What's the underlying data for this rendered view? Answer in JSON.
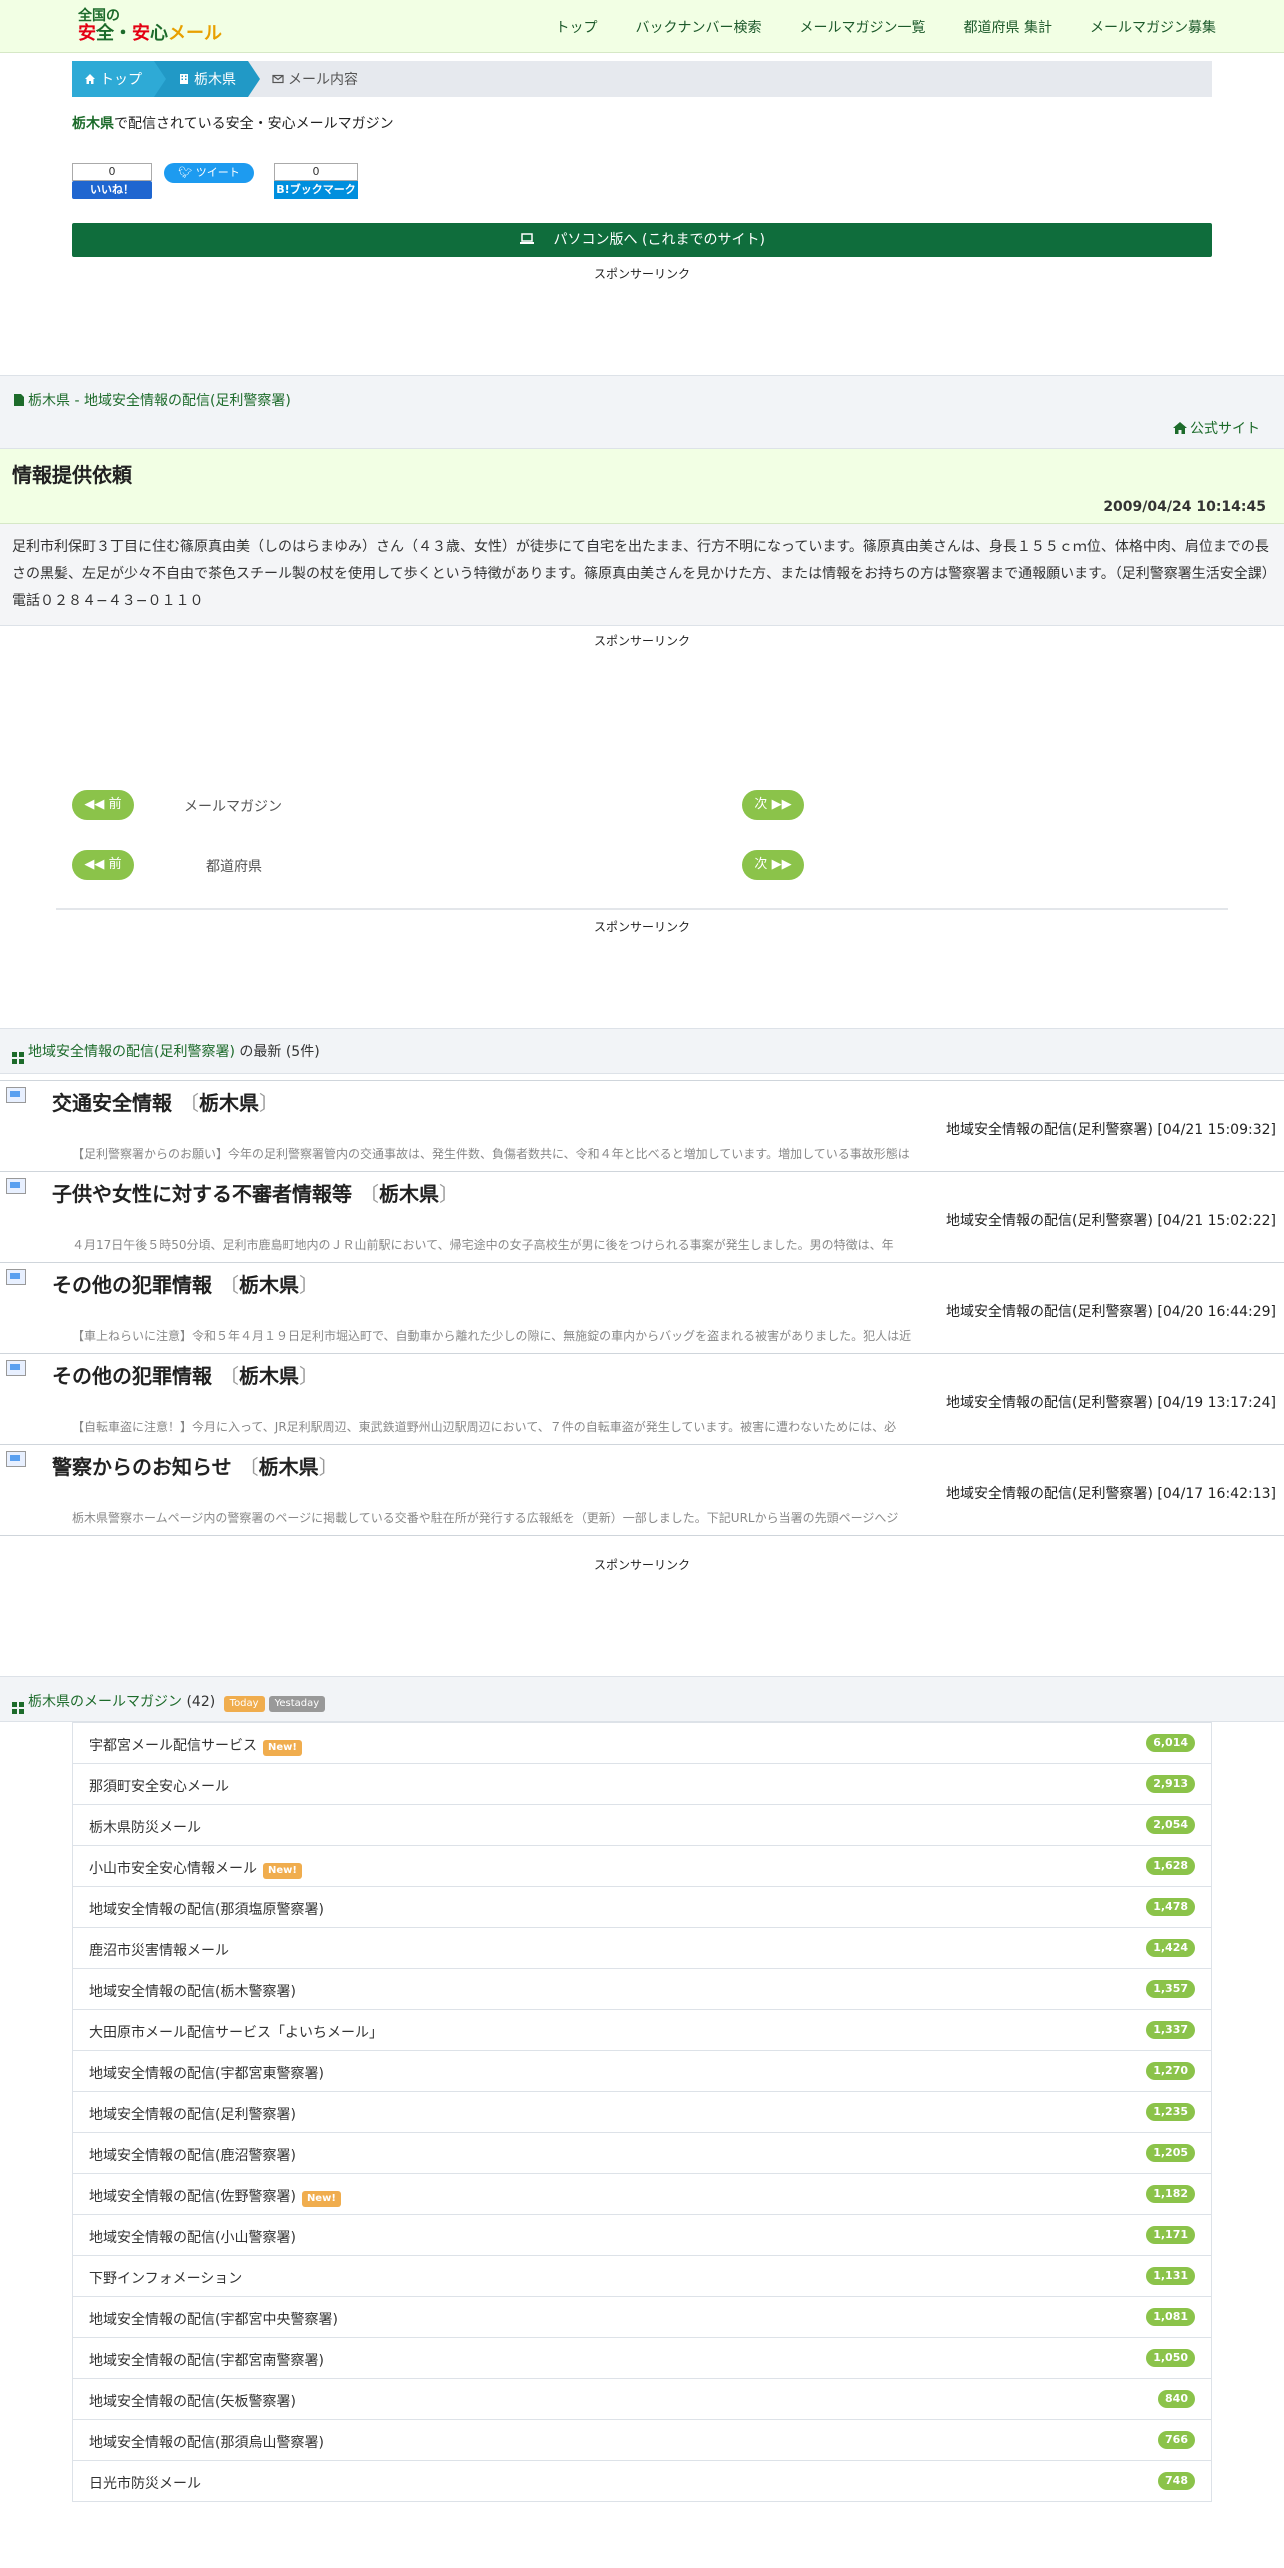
{
  "header": {
    "logo_line1": "全国の",
    "logo_a": "安",
    "logo_b": "全・",
    "logo_c": "安",
    "logo_d": "心",
    "logo_e": "メール",
    "nav": [
      "トップ",
      "バックナンバー検索",
      "メールマガジン一覧",
      "都道府県 集計",
      "メールマガジン募集"
    ]
  },
  "breadcrumb": [
    "トップ",
    "栃木県",
    "メール内容"
  ],
  "intro": {
    "pref": "栃木県",
    "text": "で配信されている安全・安心メールマガジン"
  },
  "social": {
    "fb_count": "0",
    "fb_label": "いいね！",
    "tweet_label": "ツイート",
    "hb_count": "0",
    "hb_label": "B!ブックマーク"
  },
  "pc_button": "パソコン版へ (これまでのサイト)",
  "sponsor": "スポンサーリンク",
  "source": {
    "title": "栃木県 - 地域安全情報の配信(足利警察署)",
    "official": "公式サイト"
  },
  "mail": {
    "title": "情報提供依頼",
    "date": "2009/04/24 10:14:45",
    "body": "足利市利保町３丁目に住む篠原真由美（しのはらまゆみ）さん（４３歳、女性）が徒歩にて自宅を出たまま、行方不明になっています。篠原真由美さんは、身長１５５ｃｍ位、体格中肉、肩位までの長さの黒髪、左足が少々不自由で茶色スチール製の杖を使用して歩くという特徴があります。篠原真由美さんを見かけた方、または情報をお持ちの方は警察署まで通報願います。（足利警察署生活安全課）電話０２８４−４３−０１１０"
  },
  "pager": {
    "prev": "前",
    "next": "次",
    "row1_label": "メールマガジン",
    "row2_label": "都道府県"
  },
  "latest": {
    "link": "地域安全情報の配信(足利警察署)",
    "suffix": "の最新 (5件)",
    "items": [
      {
        "title": "交通安全情報",
        "pref": "栃木県",
        "meta": "地域安全情報の配信(足利警察署) [04/21 15:09:32]",
        "summary": "【足利警察署からのお願い】今年の足利警察署管内の交通事故は、発生件数、負傷者数共に、令和４年と比べると増加しています。増加している事故形態は"
      },
      {
        "title": "子供や女性に対する不審者情報等",
        "pref": "栃木県",
        "meta": "地域安全情報の配信(足利警察署) [04/21 15:02:22]",
        "summary": "４月17日午後５時50分頃、足利市鹿島町地内のＪＲ山前駅において、帰宅途中の女子高校生が男に後をつけられる事案が発生しました。男の特徴は、年"
      },
      {
        "title": "その他の犯罪情報",
        "pref": "栃木県",
        "meta": "地域安全情報の配信(足利警察署) [04/20 16:44:29]",
        "summary": "【車上ねらいに注意】令和５年４月１９日足利市堀込町で、自動車から離れた少しの隙に、無施錠の車内からバッグを盗まれる被害がありました。犯人は近"
      },
      {
        "title": "その他の犯罪情報",
        "pref": "栃木県",
        "meta": "地域安全情報の配信(足利警察署) [04/19 13:17:24]",
        "summary": "【自転車盗に注意！】今月に入って、JR足利駅周辺、東武鉄道野州山辺駅周辺において、７件の自転車盗が発生しています。被害に遭わないためには、必"
      },
      {
        "title": "警察からのお知らせ",
        "pref": "栃木県",
        "meta": "地域安全情報の配信(足利警察署) [04/17 16:42:13]",
        "summary": "栃木県警察ホームページ内の警察署のページに掲載している交番や駐在所が発行する広報紙を（更新）一部しました。下記URLから当署の先頭ページへジ"
      }
    ]
  },
  "magazines": {
    "link": "栃木県のメールマガジン",
    "count": "(42)",
    "today": "Today",
    "yesterday": "Yestaday",
    "new_label": "New!",
    "items": [
      {
        "name": "宇都宮メール配信サービス",
        "count": "6,014",
        "new": true
      },
      {
        "name": "那須町安全安心メール",
        "count": "2,913",
        "new": false
      },
      {
        "name": "栃木県防災メール",
        "count": "2,054",
        "new": false
      },
      {
        "name": "小山市安全安心情報メール",
        "count": "1,628",
        "new": true
      },
      {
        "name": "地域安全情報の配信(那須塩原警察署)",
        "count": "1,478",
        "new": false
      },
      {
        "name": "鹿沼市災害情報メール",
        "count": "1,424",
        "new": false
      },
      {
        "name": "地域安全情報の配信(栃木警察署)",
        "count": "1,357",
        "new": false
      },
      {
        "name": "大田原市メール配信サービス「よいちメール」",
        "count": "1,337",
        "new": false
      },
      {
        "name": "地域安全情報の配信(宇都宮東警察署)",
        "count": "1,270",
        "new": false
      },
      {
        "name": "地域安全情報の配信(足利警察署)",
        "count": "1,235",
        "new": false
      },
      {
        "name": "地域安全情報の配信(鹿沼警察署)",
        "count": "1,205",
        "new": false
      },
      {
        "name": "地域安全情報の配信(佐野警察署)",
        "count": "1,182",
        "new": true
      },
      {
        "name": "地域安全情報の配信(小山警察署)",
        "count": "1,171",
        "new": false
      },
      {
        "name": "下野インフォメーション",
        "count": "1,131",
        "new": false
      },
      {
        "name": "地域安全情報の配信(宇都宮中央警察署)",
        "count": "1,081",
        "new": false
      },
      {
        "name": "地域安全情報の配信(宇都宮南警察署)",
        "count": "1,050",
        "new": false
      },
      {
        "name": "地域安全情報の配信(矢板警察署)",
        "count": "840",
        "new": false
      },
      {
        "name": "地域安全情報の配信(那須烏山警察署)",
        "count": "766",
        "new": false
      },
      {
        "name": "日光市防災メール",
        "count": "748",
        "new": false
      }
    ]
  }
}
